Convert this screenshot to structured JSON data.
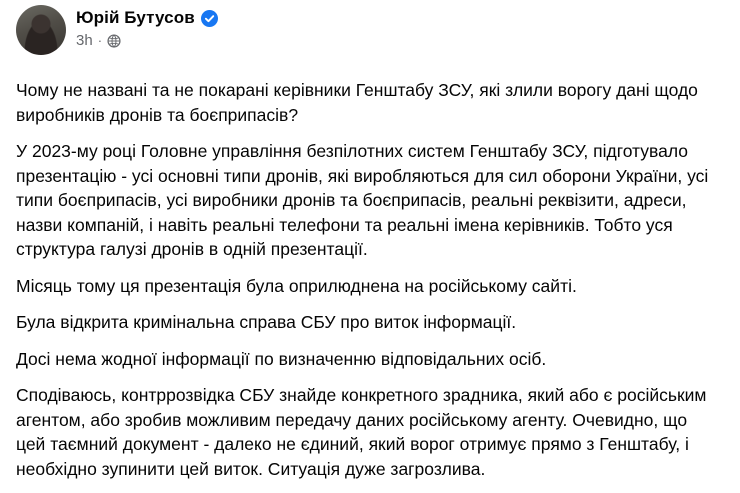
{
  "author": {
    "name": "Юрій Бутусов",
    "verified_icon": "verified-badge-icon",
    "time": "3h",
    "separator": "·",
    "audience_icon": "globe-icon"
  },
  "colors": {
    "text": "#050505",
    "secondary_text": "#65676b",
    "verified_blue": "#1877f2",
    "background": "#ffffff"
  },
  "post": {
    "paragraphs": [
      "Чому не названі та не покарані керівники Генштабу ЗСУ, які злили ворогу дані щодо виробників дронів та боєприпасів?",
      "У 2023-му році Головне управління безпілотних систем Генштабу ЗСУ, підготувало презентацію - усі основні типи дронів, які виробляються для сил оборони України, усі типи боєприпасів, усі виробники дронів та боєприпасів, реальні реквізити, адреси, назви компаній, і навіть реальні телефони та реальні імена керівників. Тобто уся структура галузі дронів в одній презентації.",
      "Місяць тому ця презентація була оприлюднена на російському сайті.",
      "Була відкрита кримінальна справа СБУ про виток інформації.",
      "Досі нема жодної інформації по визначенню відповідальних осіб.",
      "Сподіваюсь, контррозвідка СБУ знайде конкретного зрадника, який або є російським агентом, або зробив можливим передачу даних російському агенту. Очевидно, що цей таємний документ - далеко не єдиний, який ворог отримує прямо з Генштабу, і необхідно зупинити цей виток. Ситуація дуже загрозлива."
    ]
  }
}
